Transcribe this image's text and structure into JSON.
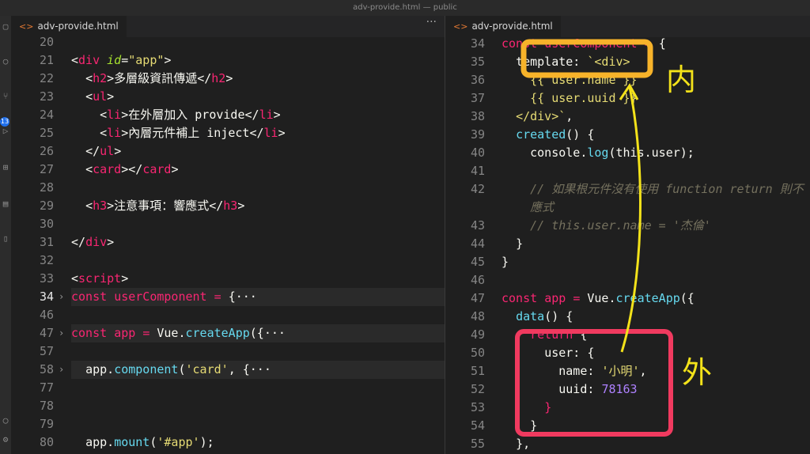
{
  "window_title": "adv-provide.html — public",
  "activity": {
    "badge": "13"
  },
  "left": {
    "tab": "adv-provide.html",
    "more": "···",
    "lines": [
      {
        "n": "20",
        "html": ""
      },
      {
        "n": "21",
        "html": "<span class='p'>&lt;</span><span class='t'>div</span> <span class='a'>id</span><span class='p'>=</span><span class='s'>\"app\"</span><span class='p'>&gt;</span>"
      },
      {
        "n": "22",
        "html": "  <span class='p'>&lt;</span><span class='t'>h2</span><span class='p'>&gt;多層級資訊傳遞&lt;/</span><span class='t'>h2</span><span class='p'>&gt;</span>"
      },
      {
        "n": "23",
        "html": "  <span class='p'>&lt;</span><span class='t'>ul</span><span class='p'>&gt;</span>"
      },
      {
        "n": "24",
        "html": "    <span class='p'>&lt;</span><span class='t'>li</span><span class='p'>&gt;在外層加入 provide&lt;/</span><span class='t'>li</span><span class='p'>&gt;</span>"
      },
      {
        "n": "25",
        "html": "    <span class='p'>&lt;</span><span class='t'>li</span><span class='p'>&gt;內層元件補上 inject&lt;/</span><span class='t'>li</span><span class='p'>&gt;</span>"
      },
      {
        "n": "26",
        "html": "  <span class='p'>&lt;/</span><span class='t'>ul</span><span class='p'>&gt;</span>"
      },
      {
        "n": "27",
        "html": "  <span class='p'>&lt;</span><span class='t'>card</span><span class='p'>&gt;&lt;/</span><span class='t'>card</span><span class='p'>&gt;</span>"
      },
      {
        "n": "28",
        "html": ""
      },
      {
        "n": "29",
        "html": "  <span class='p'>&lt;</span><span class='t'>h3</span><span class='p'>&gt;注意事項：響應式&lt;/</span><span class='t'>h3</span><span class='p'>&gt;</span>"
      },
      {
        "n": "30",
        "html": ""
      },
      {
        "n": "31",
        "html": "<span class='p'>&lt;/</span><span class='t'>div</span><span class='p'>&gt;</span>"
      },
      {
        "n": "32",
        "html": ""
      },
      {
        "n": "33",
        "html": "<span class='p'>&lt;</span><span class='t'>script</span><span class='p'>&gt;</span>"
      },
      {
        "n": "34",
        "cur": true,
        "fold": true,
        "hl": true,
        "html": "<span class='k'>const</span> <span class='k'>userComponent</span> <span class='k'>=</span> <span class='p'>{</span><span class='p'>···</span>"
      },
      {
        "n": "46",
        "html": ""
      },
      {
        "n": "47",
        "fold": true,
        "hl": true,
        "html": "<span class='k'>const</span> <span class='k'>app</span> <span class='k'>=</span> <span class='p'>Vue.</span><span class='f'>createApp</span><span class='p'>({···</span>"
      },
      {
        "n": "57",
        "html": ""
      },
      {
        "n": "58",
        "fold": true,
        "hl": true,
        "html": "  <span class='p'>app.</span><span class='f'>component</span><span class='p'>(</span><span class='s'>'card'</span><span class='p'>, {···</span>"
      },
      {
        "n": "77",
        "html": ""
      },
      {
        "n": "78",
        "html": ""
      },
      {
        "n": "79",
        "html": ""
      },
      {
        "n": "80",
        "html": "  <span class='p'>app.</span><span class='f'>mount</span><span class='p'>(</span><span class='s'>'#app'</span><span class='p'>);</span>"
      }
    ]
  },
  "right": {
    "tab": "adv-provide.html",
    "lines": [
      {
        "n": "34",
        "html": "<span class='k'>const</span> <span class='k'>userComponent</span> <span class='k'>=</span> <span class='p'>{</span>"
      },
      {
        "n": "35",
        "html": "  <span class='p'>template: </span><span class='s'>`&lt;div&gt;</span>"
      },
      {
        "n": "36",
        "html": "    <span class='s'>{{ user.name }}</span>"
      },
      {
        "n": "37",
        "html": "    <span class='s'>{{ user.uuid }}</span>"
      },
      {
        "n": "38",
        "html": "  <span class='s'>&lt;/div&gt;`</span><span class='p'>,</span>"
      },
      {
        "n": "39",
        "html": "  <span class='f'>created</span><span class='p'>() {</span>"
      },
      {
        "n": "40",
        "html": "    <span class='p'>console.</span><span class='f'>log</span><span class='p'>(this.user);</span>"
      },
      {
        "n": "41",
        "html": ""
      },
      {
        "n": "42",
        "html": "    <span class='c'>// 如果根元件沒有使用 function return 則不</span>"
      },
      {
        "n": "",
        "html": "    <span class='c'>應式</span>"
      },
      {
        "n": "43",
        "html": "    <span class='c'>// this.user.name = '杰倫'</span>"
      },
      {
        "n": "44",
        "html": "  <span class='p'>}</span>"
      },
      {
        "n": "45",
        "html": "<span class='p'>}</span>"
      },
      {
        "n": "46",
        "html": ""
      },
      {
        "n": "47",
        "html": "<span class='k'>const</span> <span class='k'>app</span> <span class='k'>=</span> <span class='p'>Vue.</span><span class='f'>createApp</span><span class='p'>({</span>"
      },
      {
        "n": "48",
        "html": "  <span class='f'>data</span><span class='p'>() {</span>"
      },
      {
        "n": "49",
        "html": "    <span class='k'>return</span> <span class='p'>{</span>"
      },
      {
        "n": "50",
        "html": "      <span class='p'>user: {</span>"
      },
      {
        "n": "51",
        "html": "        <span class='p'>name: </span><span class='s'>'小明'</span><span class='p'>,</span>"
      },
      {
        "n": "52",
        "html": "        <span class='p'>uuid: </span><span class='n'>78163</span>"
      },
      {
        "n": "53",
        "html": "      <span class='k'>}</span>"
      },
      {
        "n": "54",
        "html": "    <span class='p'>}</span>"
      },
      {
        "n": "55",
        "html": "  <span class='p'>},</span>"
      }
    ]
  },
  "annotations": {
    "inner_label": "内",
    "outer_label": "外",
    "box_inner_color": "#f7b32a",
    "box_outer_color": "#f03a5f",
    "arrow_color": "#f3e21a"
  }
}
